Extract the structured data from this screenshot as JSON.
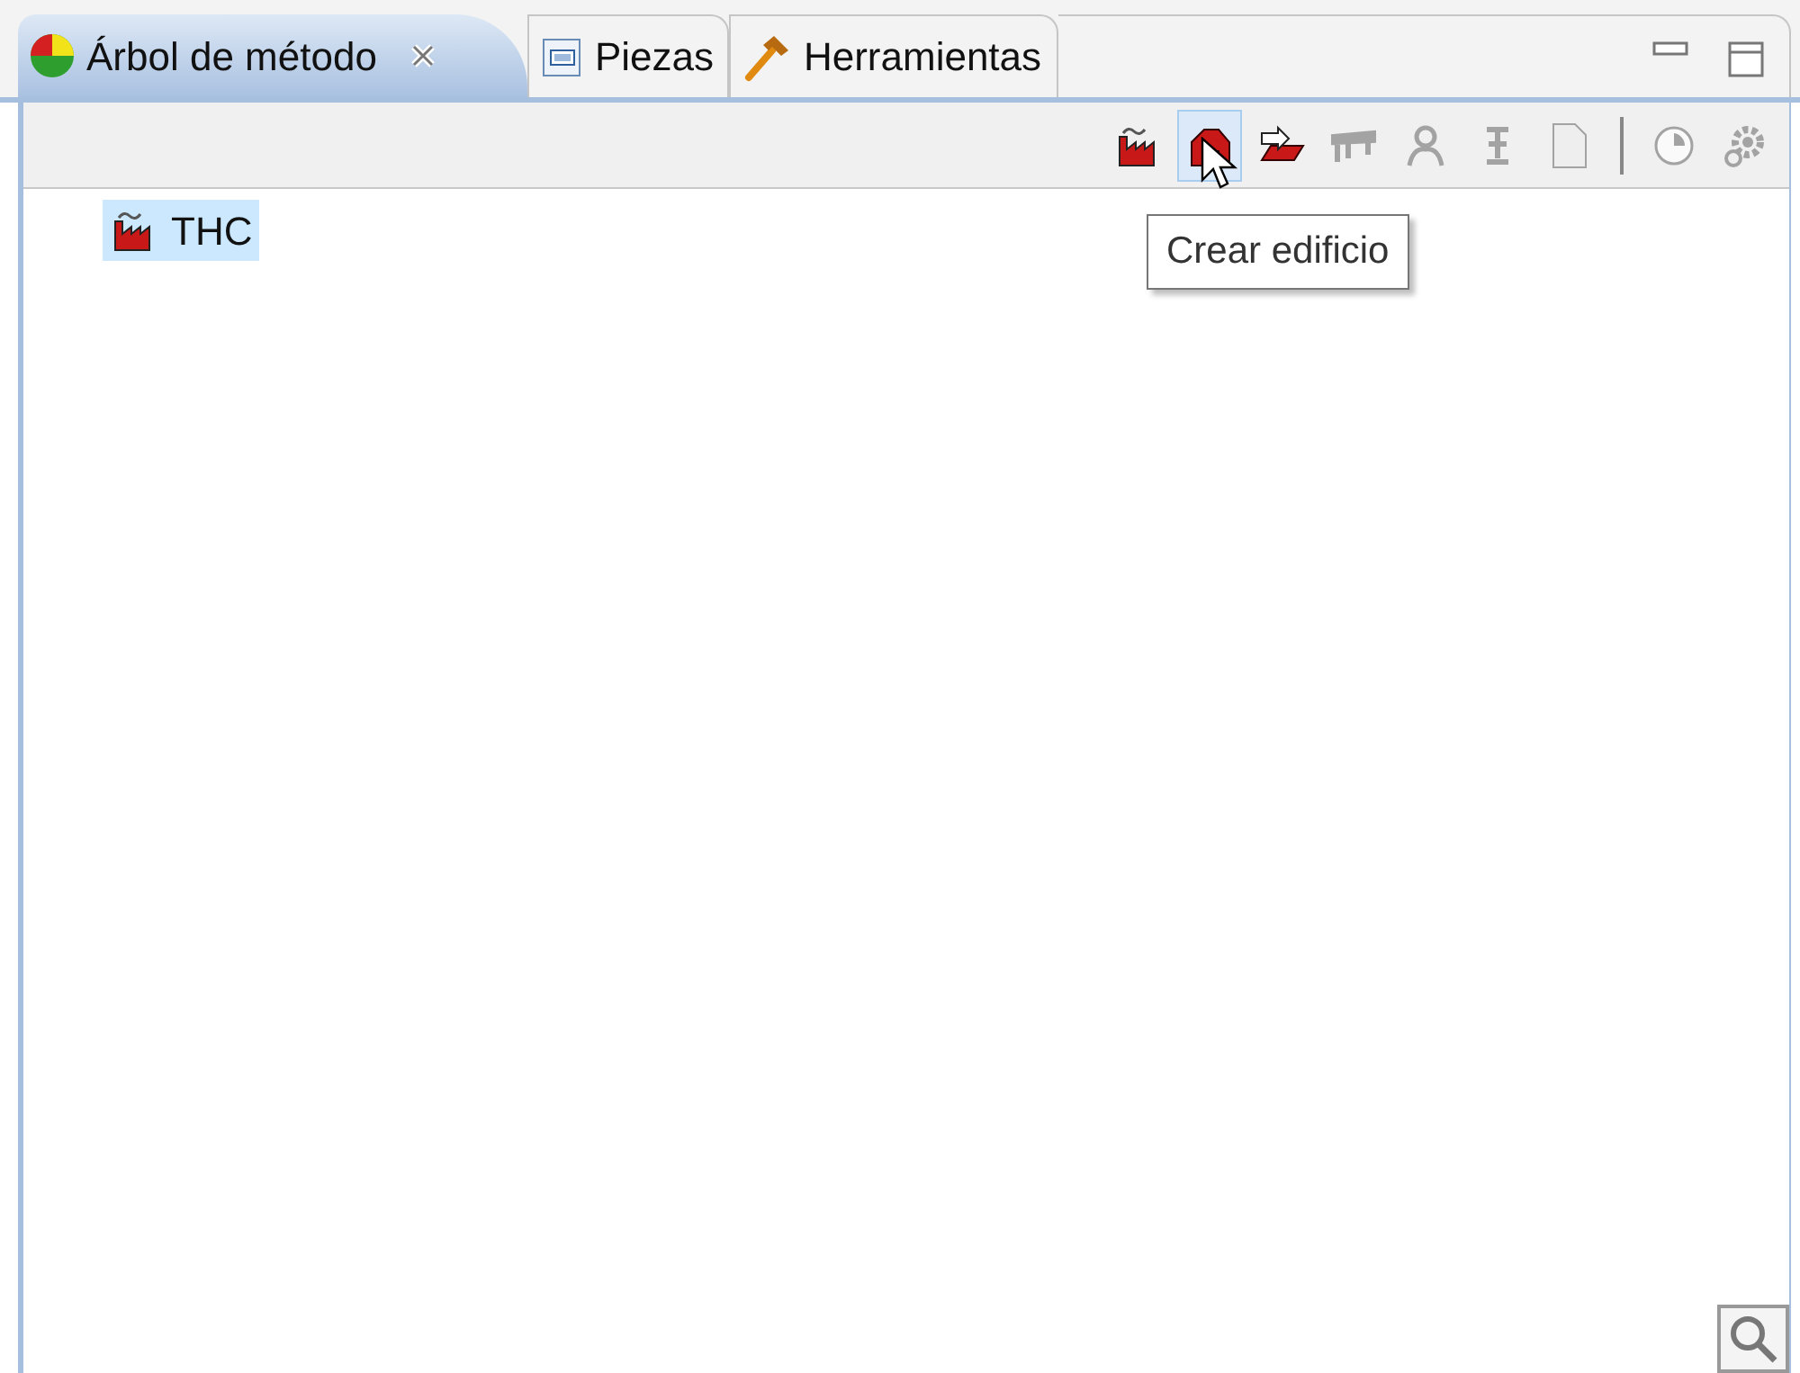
{
  "tabs": [
    {
      "label": "Árbol de método",
      "kind": "tree",
      "selected": true,
      "closable": true
    },
    {
      "label": "Piezas",
      "kind": "parts",
      "selected": false,
      "closable": false
    },
    {
      "label": "Herramientas",
      "kind": "tools",
      "selected": false,
      "closable": false
    }
  ],
  "toolbar": [
    {
      "kind": "factory",
      "disabled": false,
      "hovered": false
    },
    {
      "kind": "building",
      "disabled": false,
      "hovered": true
    },
    {
      "kind": "import",
      "disabled": false,
      "hovered": false
    },
    {
      "kind": "gantry",
      "disabled": true,
      "hovered": false
    },
    {
      "kind": "person",
      "disabled": true,
      "hovered": false
    },
    {
      "kind": "robot",
      "disabled": true,
      "hovered": false
    },
    {
      "kind": "document",
      "disabled": true,
      "hovered": false
    },
    {
      "kind": "separator"
    },
    {
      "kind": "clock",
      "disabled": true,
      "hovered": false
    },
    {
      "kind": "gear",
      "disabled": true,
      "hovered": false
    }
  ],
  "tooltip": "Crear edificio",
  "tree": [
    {
      "label": "THC",
      "selected": true
    }
  ]
}
